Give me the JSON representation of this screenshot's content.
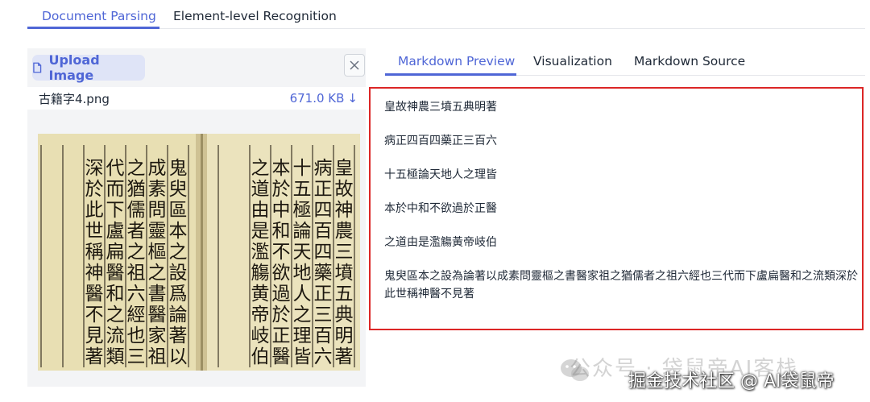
{
  "top_tabs": [
    {
      "label": "Document Parsing",
      "active": true
    },
    {
      "label": "Element-level Recognition",
      "active": false
    }
  ],
  "left": {
    "upload_label": "Upload Image",
    "file_name": "古籍字4.png",
    "file_size": "671.0 KB",
    "download_glyph": "↓",
    "image_columns": [
      "皇故神農三墳五典明著",
      "病正四百四藥正三百六",
      "十五極論天地人之理皆",
      "本於中和不欲過於正醫",
      "之道由是濫觴黄帝岐伯",
      "鬼臾區本之設爲論著以",
      "成素問靈樞之書醫家祖",
      "之猶儒者之祖六經也三",
      "代而下盧扁醫和之流類",
      "深於此世稱神醫不見著"
    ]
  },
  "right_tabs": [
    {
      "label": "Markdown Preview",
      "active": true
    },
    {
      "label": "Visualization",
      "active": false
    },
    {
      "label": "Markdown Source",
      "active": false
    }
  ],
  "preview_lines": [
    "皇故神農三墳五典明著",
    "病正四百四藥正三百六",
    "十五極論天地人之理皆",
    "本於中和不欲過於正醫",
    "之道由是濫觴黃帝岐伯",
    "鬼臾區本之設為論著以成素問靈樞之書醫家祖之猶儒者之祖六經也三代而下盧扁醫和之流類深於此世稱神醫不見著"
  ],
  "watermark": {
    "line1": "公众号 · 袋鼠帝AI客栈",
    "line2": "掘金技术社区 @ AI袋鼠帝"
  },
  "colors": {
    "accent": "#4f66d6",
    "highlight_border": "#dc2626",
    "panel_bg": "#f3f4f6"
  }
}
